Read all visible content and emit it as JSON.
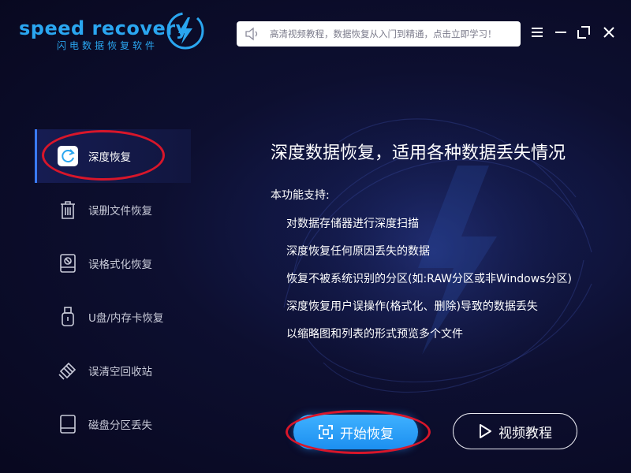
{
  "app": {
    "brand": "speed recovery",
    "brand_sub": "闪电数据恢复软件"
  },
  "notice": {
    "text": "高清视频教程，数据恢复从入门到精通，点击立即学习！"
  },
  "window_controls": [
    "menu-icon",
    "minimize-icon",
    "maximize-icon",
    "close-icon"
  ],
  "sidebar": {
    "items": [
      {
        "label": "深度恢复",
        "icon": "refresh-icon",
        "active": true
      },
      {
        "label": "误删文件恢复",
        "icon": "trash-icon",
        "active": false
      },
      {
        "label": "误格式化恢复",
        "icon": "format-disk-icon",
        "active": false
      },
      {
        "label": "U盘/内存卡恢复",
        "icon": "usb-icon",
        "active": false
      },
      {
        "label": "误清空回收站",
        "icon": "recycle-icon",
        "active": false
      },
      {
        "label": "磁盘分区丢失",
        "icon": "disk-icon",
        "active": false
      }
    ]
  },
  "main": {
    "headline": "深度数据恢复，适用各种数据丢失情况",
    "support_title": "本功能支持:",
    "features": [
      "对数据存储器进行深度扫描",
      "深度恢复任何原因丢失的数据",
      "恢复不被系统识别的分区(如:RAW分区或非Windows分区)",
      "深度恢复用户误操作(格式化、删除)导致的数据丢失",
      "以缩略图和列表的形式预览多个文件"
    ],
    "start_button": "开始恢复",
    "video_button": "视频教程"
  },
  "colors": {
    "accent": "#2aa6f0",
    "highlight_ring": "#d8162a",
    "background": "#0b0b26"
  }
}
